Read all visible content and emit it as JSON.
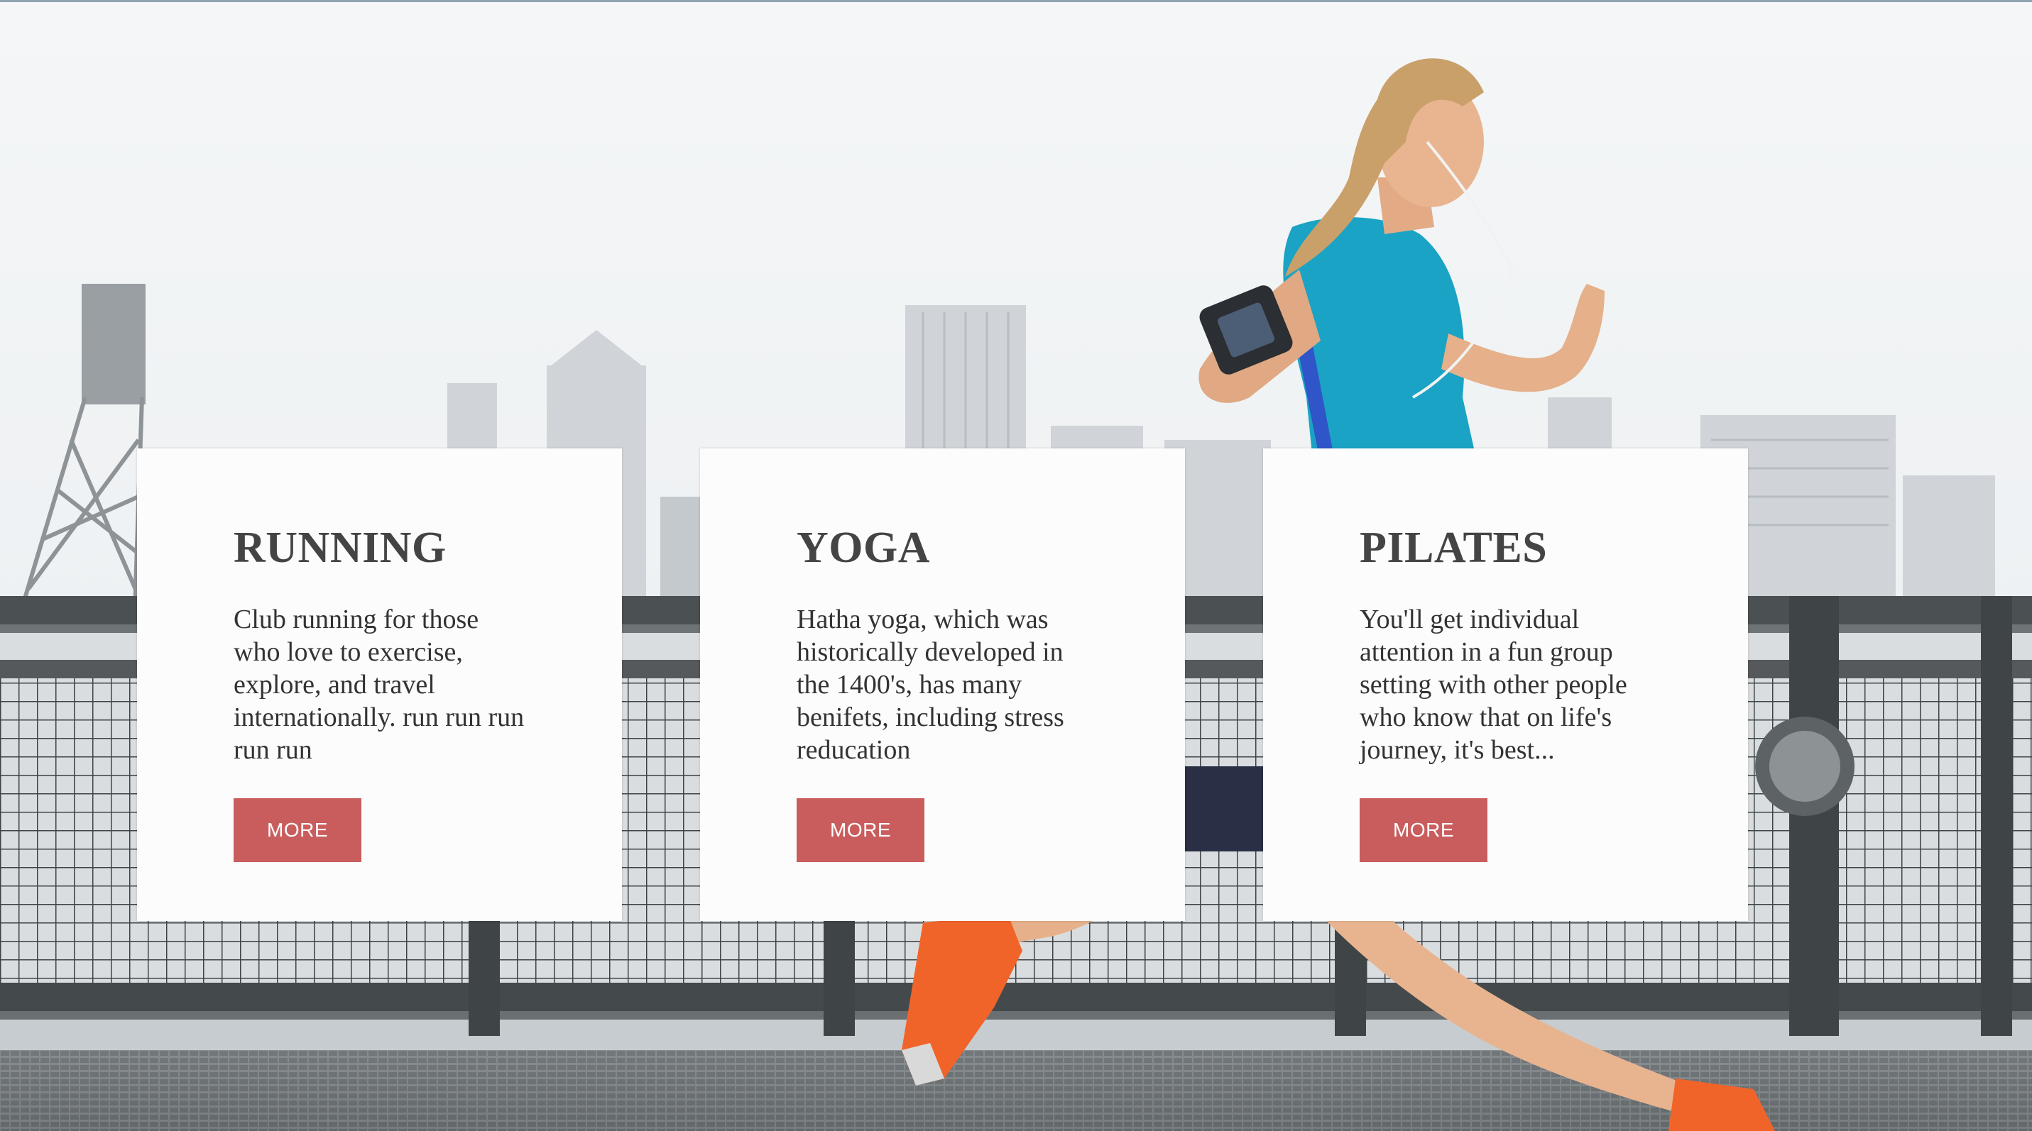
{
  "colors": {
    "button_bg": "#c95d5d",
    "button_text": "#ffffff",
    "card_bg": "#fcfcfc",
    "title": "#444444",
    "body_text": "#333333",
    "shirt": "#1aa3c4",
    "shoe": "#f0642a"
  },
  "cards": [
    {
      "title": "RUNNING",
      "text": "Club running for those who love to exercise, explore, and travel internationally. run run run run run",
      "button_label": "MORE"
    },
    {
      "title": "YOGA",
      "text": "Hatha yoga, which was historically developed in the 1400's, has many benifets, including stress reducation",
      "button_label": "MORE"
    },
    {
      "title": "PILATES",
      "text": "You'll get individual attention in a fun group setting with other people who know that on life's journey, it's best...",
      "button_label": "MORE"
    }
  ]
}
